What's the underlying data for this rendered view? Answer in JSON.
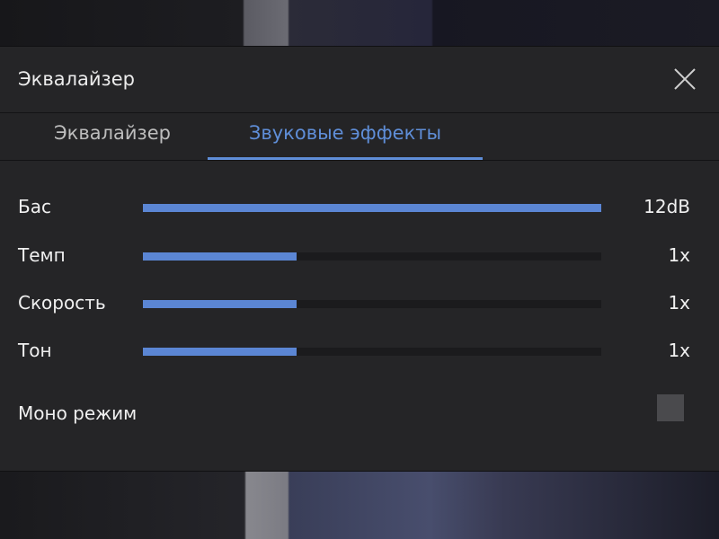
{
  "dialog": {
    "title": "Эквалайзер"
  },
  "tabs": [
    {
      "label": "Эквалайзер",
      "active": false
    },
    {
      "label": "Звуковые эффекты",
      "active": true
    }
  ],
  "effects": [
    {
      "label": "Бас",
      "value_text": "12dB",
      "level_fraction": 1.0
    },
    {
      "label": "Темп",
      "value_text": "1x",
      "level_fraction": 0.335
    },
    {
      "label": "Скорость",
      "value_text": "1x",
      "level_fraction": 0.335
    },
    {
      "label": "Тон",
      "value_text": "1x",
      "level_fraction": 0.335
    }
  ],
  "mono": {
    "label": "Моно режим",
    "checked": false
  },
  "colors": {
    "accent": "#5b86d4",
    "dialog_bg": "#252527",
    "track_bg": "#1b1b1d"
  },
  "icons": {
    "close": "close-icon"
  }
}
